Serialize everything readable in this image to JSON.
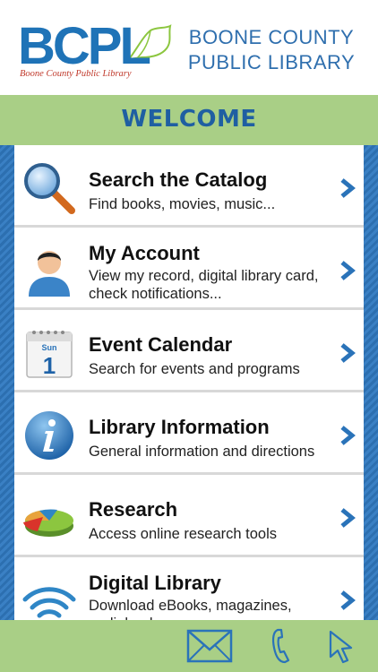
{
  "header": {
    "logo_text": "BCPL",
    "logo_subtitle": "Boone County Public Library",
    "title": "BOONE COUNTY PUBLIC LIBRARY"
  },
  "welcome": {
    "label": "WELCOME"
  },
  "menu": {
    "items": [
      {
        "title": "Search the Catalog",
        "description": "Find books, movies, music...",
        "icon": "magnifier-icon"
      },
      {
        "title": "My Account",
        "description": "View my record, digital library card, check notifications...",
        "icon": "user-icon"
      },
      {
        "title": "Event Calendar",
        "description": "Search for events and programs",
        "icon": "calendar-icon",
        "calendar_day": "Sun",
        "calendar_date": "1"
      },
      {
        "title": "Library Information",
        "description": "General information and directions",
        "icon": "info-icon"
      },
      {
        "title": "Research",
        "description": "Access online research tools",
        "icon": "pie-chart-icon"
      },
      {
        "title": "Digital Library",
        "description": "Download eBooks, magazines, audiobooks...",
        "icon": "wifi-icon"
      }
    ]
  },
  "bottom_bar": {
    "icons": [
      "mail-icon",
      "phone-icon",
      "cursor-icon"
    ]
  },
  "colors": {
    "brand_blue": "#1f73b7",
    "bar_green": "#a9cf86",
    "stripe_blue": "#2c6fb0",
    "chevron_blue": "#2a73b9"
  }
}
